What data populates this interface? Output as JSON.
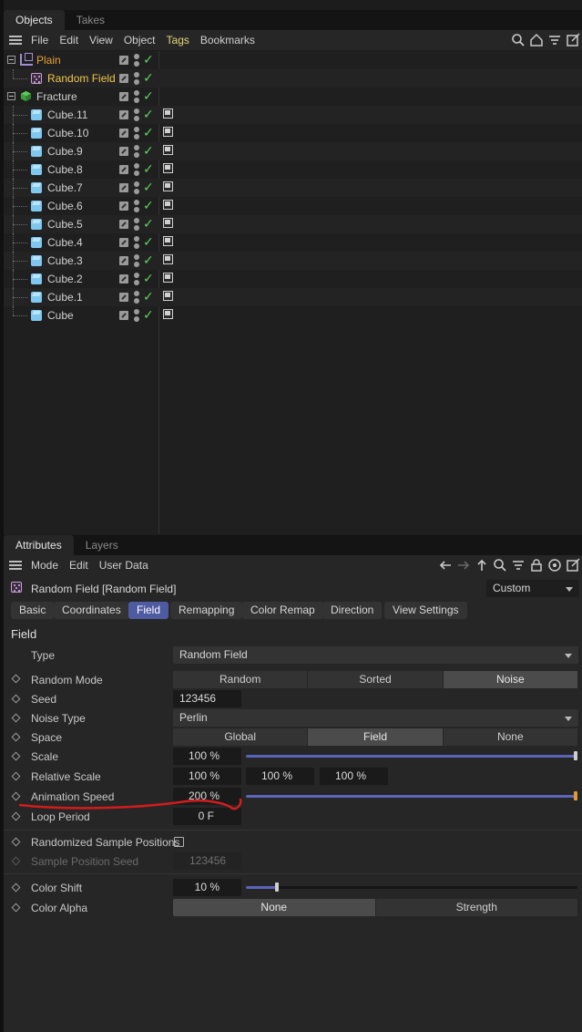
{
  "objects_panel": {
    "tabs": [
      "Objects",
      "Takes"
    ],
    "menu": [
      "File",
      "Edit",
      "View",
      "Object",
      "Tags",
      "Bookmarks"
    ],
    "items": [
      {
        "name": "Plain",
        "type": "null",
        "color": "orange",
        "tag": false
      },
      {
        "name": "Random Field",
        "type": "random-field",
        "color": "yellow",
        "tag": false
      },
      {
        "name": "Fracture",
        "type": "fracture",
        "color": "normal",
        "tag": false
      },
      {
        "name": "Cube.11",
        "type": "cube",
        "color": "normal",
        "tag": true
      },
      {
        "name": "Cube.10",
        "type": "cube",
        "color": "normal",
        "tag": true
      },
      {
        "name": "Cube.9",
        "type": "cube",
        "color": "normal",
        "tag": true
      },
      {
        "name": "Cube.8",
        "type": "cube",
        "color": "normal",
        "tag": true
      },
      {
        "name": "Cube.7",
        "type": "cube",
        "color": "normal",
        "tag": true
      },
      {
        "name": "Cube.6",
        "type": "cube",
        "color": "normal",
        "tag": true
      },
      {
        "name": "Cube.5",
        "type": "cube",
        "color": "normal",
        "tag": true
      },
      {
        "name": "Cube.4",
        "type": "cube",
        "color": "normal",
        "tag": true
      },
      {
        "name": "Cube.3",
        "type": "cube",
        "color": "normal",
        "tag": true
      },
      {
        "name": "Cube.2",
        "type": "cube",
        "color": "normal",
        "tag": true
      },
      {
        "name": "Cube.1",
        "type": "cube",
        "color": "normal",
        "tag": true
      },
      {
        "name": "Cube",
        "type": "cube",
        "color": "normal",
        "tag": true
      }
    ]
  },
  "attributes_panel": {
    "tabs": [
      "Attributes",
      "Layers"
    ],
    "menu": [
      "Mode",
      "Edit",
      "User Data"
    ],
    "object_title": "Random Field [Random Field]",
    "preset": "Custom",
    "section_tabs": [
      "Basic",
      "Coordinates",
      "Field",
      "Remapping",
      "Color Remap",
      "Direction",
      "View Settings"
    ],
    "active_tab": "Field",
    "section_title": "Field",
    "props": {
      "type_label": "Type",
      "type_value": "Random Field",
      "random_mode_label": "Random Mode",
      "random_mode_options": [
        "Random",
        "Sorted",
        "Noise"
      ],
      "random_mode_selected": "Noise",
      "seed_label": "Seed",
      "seed_value": "123456",
      "noise_type_label": "Noise Type",
      "noise_type_value": "Perlin",
      "space_label": "Space",
      "space_options": [
        "Global",
        "Field",
        "None"
      ],
      "space_selected": "Field",
      "scale_label": "Scale",
      "scale_value": "100 %",
      "scale_slider": 1.0,
      "relative_scale_label": "Relative Scale",
      "relative_scale_values": [
        "100 %",
        "100 %",
        "100 %"
      ],
      "animation_speed_label": "Animation Speed",
      "animation_speed_value": "200 %",
      "animation_speed_slider": 1.0,
      "loop_period_label": "Loop Period",
      "loop_period_value": "0 F",
      "randomized_label": "Randomized Sample Positions",
      "randomized_checked": false,
      "sample_seed_label": "Sample Position Seed",
      "sample_seed_value": "123456",
      "color_shift_label": "Color Shift",
      "color_shift_value": "10 %",
      "color_shift_slider": 0.1,
      "color_alpha_label": "Color Alpha",
      "color_alpha_options": [
        "None",
        "Strength"
      ],
      "color_alpha_selected": "None"
    }
  },
  "colors": {
    "accent": "#4f5ba0",
    "check": "#5fd35f",
    "highlight_orange": "#e3a23a",
    "highlight_yellow": "#f0c64a",
    "annotation": "#d21c1c"
  }
}
